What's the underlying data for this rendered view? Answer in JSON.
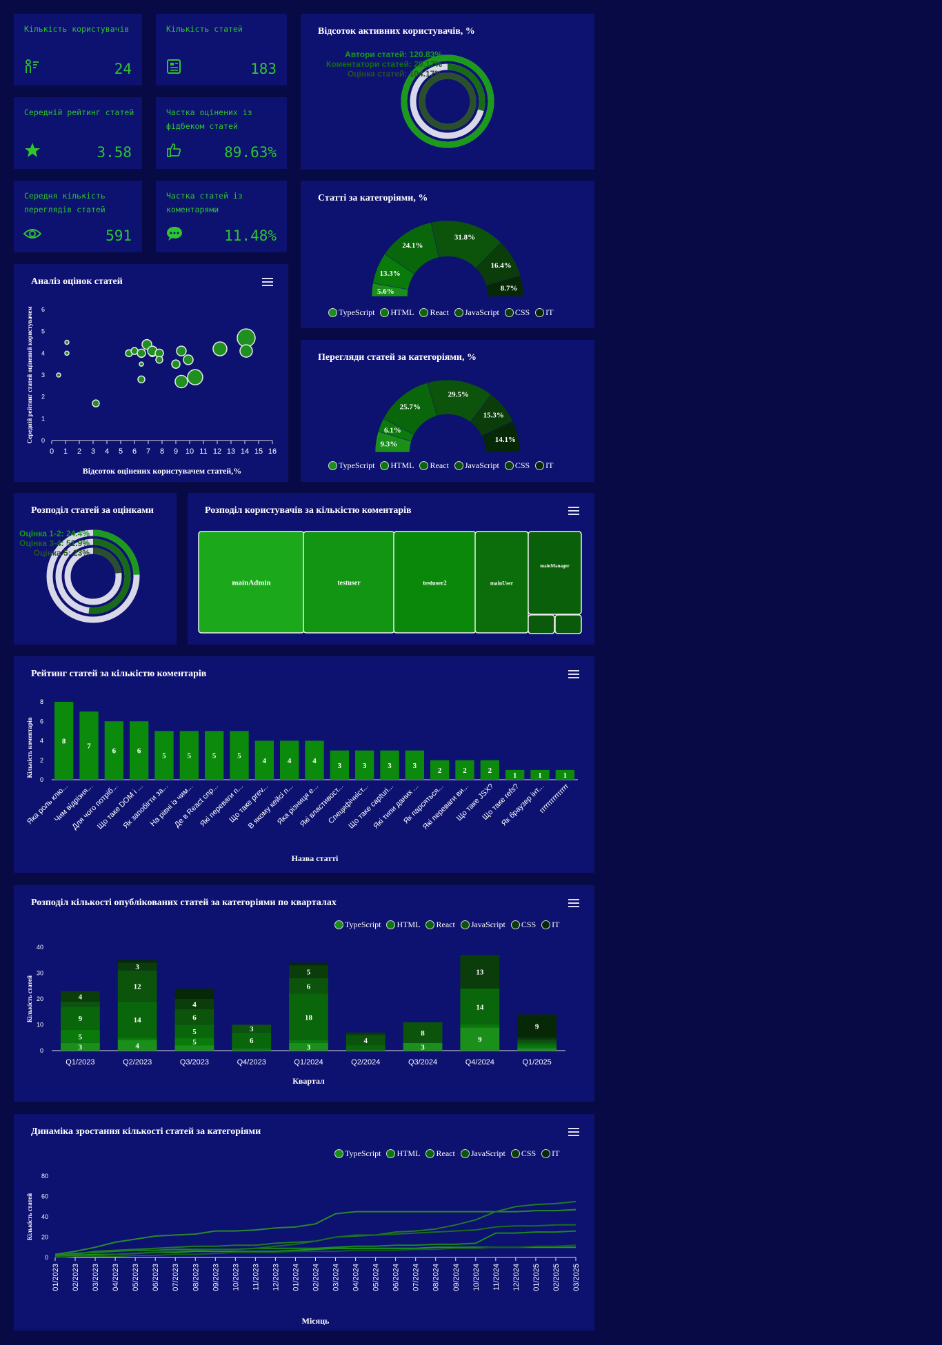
{
  "stats": [
    {
      "title": "Кількість користувачів",
      "value": "24",
      "icon": "users-icon"
    },
    {
      "title": "Кількість статей",
      "value": "183",
      "icon": "article-icon"
    },
    {
      "title": "Середній рейтинг статей",
      "value": "3.58",
      "icon": "star-icon"
    },
    {
      "title": "Частка оцінених із фідбеком статей",
      "value": "89.63%",
      "icon": "thumbs-up-icon"
    },
    {
      "title": "Середня кількість переглядів статей",
      "value": "591",
      "icon": "eye-icon"
    },
    {
      "title": "Частка статей із коментарями",
      "value": "11.48%",
      "icon": "comment-icon"
    }
  ],
  "colors": {
    "background": "#080a45",
    "panel": "#0d1170",
    "accent": "#2fc52f",
    "categories": [
      "#1a8f1a",
      "#0a7a0a",
      "#0a660a",
      "#0c530c",
      "#0a3d0a",
      "#062806"
    ]
  },
  "categories": [
    "TypeScript",
    "HTML",
    "React",
    "JavaScript",
    "CSS",
    "IT"
  ],
  "chart_data": [
    {
      "id": "active_users",
      "type": "radial-bar",
      "title": "Відсоток активних користувачів, %",
      "labels": [
        "Автори статей: 120.83%",
        "Коментатори статей: 29.17%",
        "Оцінка статей: 104.17%"
      ],
      "values": [
        120.83,
        29.17,
        104.17
      ]
    },
    {
      "id": "articles_by_category",
      "type": "pie",
      "title": "Статті за категоріями, %",
      "labels": [
        "TypeScript",
        "HTML",
        "React",
        "JavaScript",
        "CSS",
        "IT"
      ],
      "values": [
        5.6,
        13.3,
        24.1,
        31.8,
        16.4,
        8.7
      ]
    },
    {
      "id": "views_by_category",
      "type": "pie",
      "title": "Перегляди статей за категоріями, %",
      "labels": [
        "TypeScript",
        "HTML",
        "React",
        "JavaScript",
        "CSS",
        "IT"
      ],
      "values": [
        9.3,
        6.1,
        25.7,
        29.5,
        15.3,
        14.1
      ]
    },
    {
      "id": "rating_analysis",
      "type": "scatter",
      "title": "Аналіз оцінок статей",
      "xlabel": "Відсоток оцінених користувачем статей,%",
      "ylabel": "Середній рейтинг статей оцінений користувачем",
      "xticks": [
        0,
        1,
        2,
        3,
        4,
        5,
        6,
        7,
        8,
        9,
        10,
        11,
        12,
        13,
        14,
        15,
        16
      ],
      "xlim": [
        0,
        16
      ],
      "ylim": [
        0,
        6
      ],
      "yticks": [
        0,
        1,
        2,
        3,
        4,
        5,
        6
      ],
      "points": [
        {
          "x": 0.5,
          "y": 3.0,
          "r": 1
        },
        {
          "x": 1.1,
          "y": 4.5,
          "r": 1
        },
        {
          "x": 1.1,
          "y": 4.0,
          "r": 1
        },
        {
          "x": 3.2,
          "y": 1.7,
          "r": 2
        },
        {
          "x": 5.6,
          "y": 4.0,
          "r": 2
        },
        {
          "x": 6.0,
          "y": 4.1,
          "r": 2
        },
        {
          "x": 6.5,
          "y": 4.0,
          "r": 2.5
        },
        {
          "x": 6.5,
          "y": 3.5,
          "r": 1
        },
        {
          "x": 6.5,
          "y": 2.8,
          "r": 2
        },
        {
          "x": 6.9,
          "y": 4.4,
          "r": 3
        },
        {
          "x": 7.3,
          "y": 4.0,
          "r": 2
        },
        {
          "x": 7.3,
          "y": 4.1,
          "r": 3
        },
        {
          "x": 7.8,
          "y": 4.0,
          "r": 2.5
        },
        {
          "x": 7.8,
          "y": 3.7,
          "r": 2
        },
        {
          "x": 9.0,
          "y": 3.5,
          "r": 2.5
        },
        {
          "x": 9.4,
          "y": 4.1,
          "r": 3
        },
        {
          "x": 9.4,
          "y": 2.7,
          "r": 4
        },
        {
          "x": 9.9,
          "y": 3.7,
          "r": 3
        },
        {
          "x": 10.4,
          "y": 2.9,
          "r": 5
        },
        {
          "x": 12.2,
          "y": 4.2,
          "r": 4.5
        },
        {
          "x": 14.1,
          "y": 4.7,
          "r": 6
        },
        {
          "x": 14.1,
          "y": 4.1,
          "r": 4
        }
      ]
    },
    {
      "id": "ratings_distribution",
      "type": "radial-bar",
      "title": "Розподіл статей за оцінками",
      "labels": [
        "Оцінка 1-2: 24.4%",
        "Оцінка 3-4: 51.9%",
        "Оцінка 5: 23%"
      ],
      "values": [
        24.4,
        51.9,
        23
      ]
    },
    {
      "id": "users_by_comments",
      "type": "treemap",
      "title": "Розподіл користувачів за кількістю коментарів",
      "labels": [
        "mainAdmin",
        "testuser",
        "testuser2",
        "mainUser",
        "mainManager",
        "",
        ""
      ],
      "values": [
        26,
        22,
        20,
        13,
        12,
        3,
        3
      ]
    },
    {
      "id": "articles_by_comments",
      "type": "bar",
      "title": "Рейтинг статей за кількістю коментарів",
      "xlabel": "Назва статті",
      "ylabel": "Кількість коментарів",
      "ylim": [
        0,
        8
      ],
      "yticks": [
        0,
        2,
        4,
        6,
        8
      ],
      "categories": [
        "Яка роль клю...",
        "Чим відрізня...",
        "Для чого потріб...",
        "Що таке DOM і ...",
        "Як запобігти за...",
        "На рівні із чим...",
        "Де в React спр...",
        "Які переваги п...",
        "Що таке prev...",
        "В якому кейсі п...",
        "Яка різниця е...",
        "Які властивост...",
        "Специфічніст...",
        "Що таке capturi...",
        "Які типи даних ...",
        "Як парсяться...",
        "Які переваги ви...",
        "Що таке JSX?",
        "Що таке refs?",
        "Як браузер інт...",
        "rrrrrrrrrrrrrrr"
      ],
      "values": [
        8,
        7,
        6,
        6,
        5,
        5,
        5,
        5,
        4,
        4,
        4,
        3,
        3,
        3,
        3,
        2,
        2,
        2,
        1,
        1,
        1
      ]
    },
    {
      "id": "articles_by_quarter",
      "type": "bar",
      "stacked": true,
      "title": "Розподіл кількості опублікованих статей за категоріями по кварталах",
      "xlabel": "Квартал",
      "ylabel": "Кількість статей",
      "ylim": [
        0,
        40
      ],
      "yticks": [
        0,
        10,
        20,
        30,
        40
      ],
      "categories": [
        "Q1/2023",
        "Q2/2023",
        "Q3/2023",
        "Q4/2023",
        "Q1/2024",
        "Q2/2024",
        "Q3/2024",
        "Q4/2024",
        "Q1/2025"
      ],
      "series": [
        {
          "name": "TypeScript",
          "values": [
            3,
            4,
            2,
            0,
            3,
            0,
            3,
            9,
            1
          ]
        },
        {
          "name": "HTML",
          "values": [
            5,
            1,
            3,
            1,
            1,
            0,
            0,
            1,
            1
          ]
        },
        {
          "name": "React",
          "values": [
            9,
            14,
            5,
            6,
            18,
            2,
            0,
            14,
            1
          ]
        },
        {
          "name": "JavaScript",
          "values": [
            2,
            12,
            6,
            3,
            6,
            4,
            8,
            0,
            1
          ]
        },
        {
          "name": "CSS",
          "values": [
            4,
            3,
            4,
            0,
            5,
            1,
            0,
            13,
            1
          ]
        },
        {
          "name": "IT",
          "values": [
            0,
            1,
            4,
            0,
            1,
            0,
            0,
            0,
            9
          ]
        }
      ],
      "labels": [
        [
          3,
          5,
          9,
          "",
          "4",
          ""
        ],
        [
          4,
          "",
          14,
          12,
          3,
          ""
        ],
        [
          "",
          5,
          5,
          6,
          4,
          ""
        ],
        [
          "",
          "",
          6,
          3,
          "",
          ""
        ],
        [
          3,
          "",
          18,
          6,
          5,
          ""
        ],
        [
          "",
          "",
          "",
          4,
          "",
          ""
        ],
        [
          3,
          "",
          "",
          8,
          "",
          ""
        ],
        [
          9,
          "",
          14,
          "",
          13,
          ""
        ],
        [
          "",
          "",
          "",
          "",
          "",
          9
        ]
      ]
    },
    {
      "id": "articles_growth",
      "type": "line",
      "title": "Динаміка зростання кількості статей за категоріями",
      "xlabel": "Місяць",
      "ylabel": "Кількість статей",
      "ylim": [
        0,
        80
      ],
      "yticks": [
        0,
        20,
        40,
        60,
        80
      ],
      "x": [
        "01/2023",
        "02/2023",
        "03/2023",
        "04/2023",
        "05/2023",
        "06/2023",
        "07/2023",
        "08/2023",
        "09/2023",
        "10/2023",
        "11/2023",
        "12/2023",
        "01/2024",
        "02/2024",
        "03/2024",
        "04/2024",
        "05/2024",
        "06/2024",
        "07/2024",
        "08/2024",
        "09/2024",
        "10/2024",
        "11/2024",
        "12/2024",
        "01/2025",
        "02/2025",
        "03/2025"
      ],
      "series": [
        {
          "name": "TypeScript",
          "values": [
            1,
            2,
            3,
            3,
            4,
            5,
            5,
            6,
            6,
            6,
            6,
            6,
            7,
            8,
            9,
            9,
            9,
            9,
            9,
            10,
            10,
            10,
            10,
            10,
            10,
            10,
            10
          ]
        },
        {
          "name": "HTML",
          "values": [
            2,
            4,
            5,
            6,
            7,
            7,
            8,
            8,
            8,
            8,
            9,
            9,
            9,
            9,
            10,
            11,
            11,
            12,
            12,
            13,
            13,
            14,
            24,
            24,
            25,
            25,
            26
          ]
        },
        {
          "name": "React",
          "values": [
            3,
            6,
            10,
            15,
            18,
            21,
            22,
            23,
            26,
            26,
            27,
            29,
            30,
            33,
            43,
            45,
            45,
            45,
            45,
            45,
            45,
            45,
            45,
            45,
            46,
            46,
            47
          ]
        },
        {
          "name": "JavaScript",
          "values": [
            1,
            3,
            6,
            7,
            8,
            9,
            10,
            11,
            11,
            12,
            12,
            14,
            15,
            16,
            20,
            21,
            22,
            25,
            26,
            28,
            32,
            37,
            45,
            50,
            52,
            53,
            55
          ]
        },
        {
          "name": "CSS",
          "values": [
            0,
            1,
            2,
            3,
            4,
            5,
            6,
            7,
            8,
            8,
            9,
            11,
            13,
            16,
            20,
            22,
            22,
            23,
            24,
            25,
            26,
            27,
            30,
            31,
            31,
            32,
            32
          ]
        },
        {
          "name": "IT",
          "values": [
            0,
            1,
            1,
            1,
            2,
            2,
            3,
            3,
            4,
            5,
            5,
            5,
            6,
            6,
            6,
            7,
            7,
            7,
            8,
            8,
            9,
            9,
            10,
            10,
            11,
            11,
            12
          ]
        }
      ]
    }
  ]
}
